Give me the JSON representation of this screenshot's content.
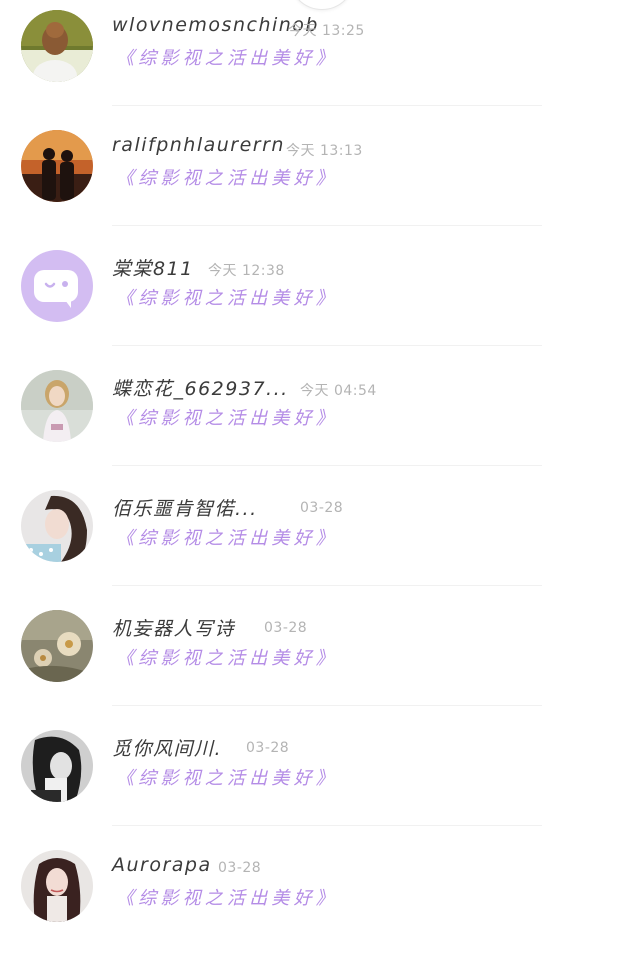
{
  "accent_color": "#b48ce6",
  "default_avatar_color": "#d3bdf2",
  "comments": [
    {
      "user": "wlovnemosnchinob",
      "time": "今天 13:25",
      "text": "《综影视之活出美好》",
      "avatar": "photo-girl-back"
    },
    {
      "user": "ralifpnhlaurerrn",
      "time": "今天 13:13",
      "text": "《综影视之活出美好》",
      "avatar": "photo-couple-sunset"
    },
    {
      "user": "棠棠811",
      "time": "今天 12:38",
      "text": "《综影视之活出美好》",
      "avatar": "default-chat-bubble-icon"
    },
    {
      "user": "蝶恋花_662937...",
      "time": "今天 04:54",
      "text": "《综影视之活出美好》",
      "avatar": "photo-woman-dress"
    },
    {
      "user": "佰乐噩肯智偌...",
      "time": "03-28",
      "text": "《综影视之活出美好》",
      "avatar": "photo-girl-selfie"
    },
    {
      "user": "机妄器人写诗",
      "time": "03-28",
      "text": "《综影视之活出美好》",
      "avatar": "photo-flowers"
    },
    {
      "user": "觅你风间川.",
      "time": "03-28",
      "text": "《综影视之活出美好》",
      "avatar": "photo-bw-girl"
    },
    {
      "user": "Aurorapa",
      "time": "03-28",
      "text": "《综影视之活出美好》",
      "avatar": "photo-girl-portrait"
    }
  ]
}
